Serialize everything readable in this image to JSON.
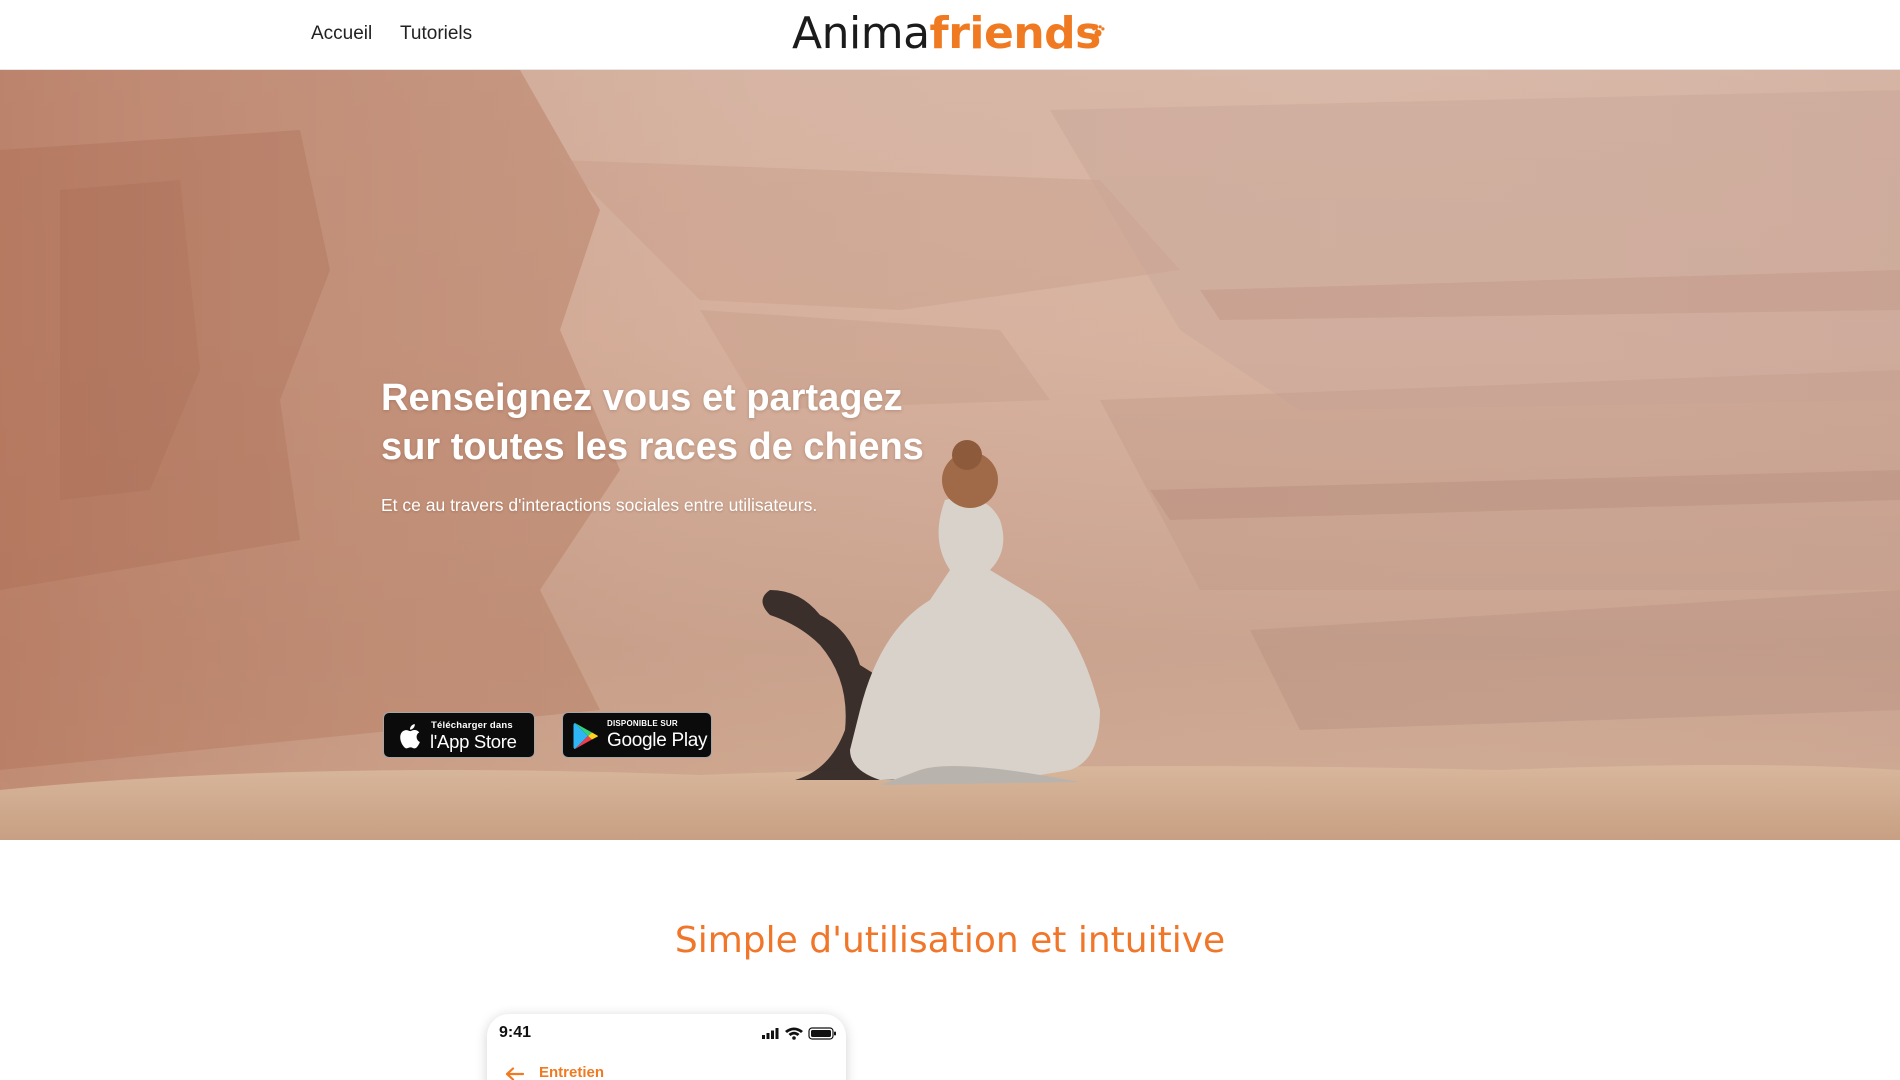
{
  "header": {
    "nav": [
      {
        "label": "Accueil"
      },
      {
        "label": "Tutoriels"
      }
    ],
    "logo": {
      "part1": "Anima",
      "part2": "friends",
      "icon": "paw-icon"
    }
  },
  "hero": {
    "title_line1": "Renseignez vous et partagez",
    "title_line2": "sur toutes les races de chiens",
    "subtitle": "Et ce au travers d'interactions sociales entre utilisateurs.",
    "background": "canyon photo with woman and dog",
    "appstore": {
      "small": "Télécharger dans",
      "big": "l'App Store",
      "icon": "apple-icon"
    },
    "googleplay": {
      "small": "DISPONIBLE SUR",
      "big": "Google Play",
      "icon": "google-play-icon"
    }
  },
  "features": {
    "title": "Simple d'utilisation et intuitive",
    "phone": {
      "time": "9:41",
      "screen_title": "Entretien",
      "icons": [
        "signal-icon",
        "wifi-icon",
        "battery-icon",
        "back-arrow-icon"
      ]
    }
  },
  "colors": {
    "accent": "#f07a22",
    "section_title": "#f0762a",
    "text_dark": "#222222"
  }
}
